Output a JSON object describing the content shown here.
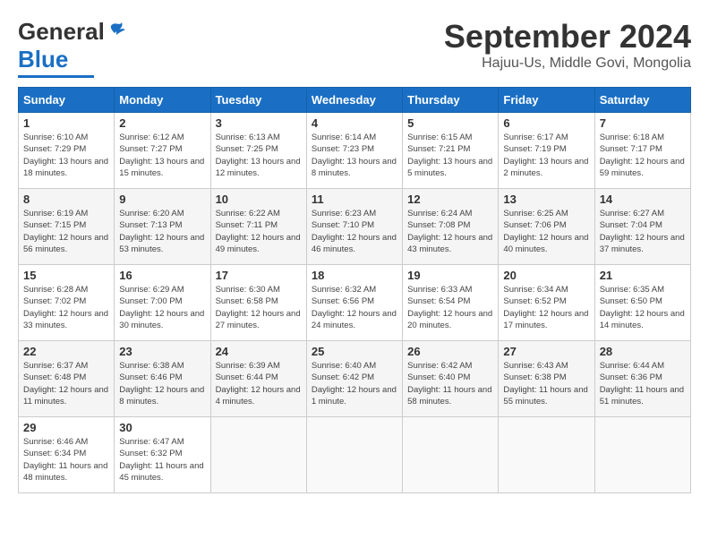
{
  "header": {
    "logo_general": "General",
    "logo_blue": "Blue",
    "title": "September 2024",
    "location": "Hajuu-Us, Middle Govi, Mongolia"
  },
  "weekdays": [
    "Sunday",
    "Monday",
    "Tuesday",
    "Wednesday",
    "Thursday",
    "Friday",
    "Saturday"
  ],
  "weeks": [
    [
      {
        "day": "1",
        "sunrise": "Sunrise: 6:10 AM",
        "sunset": "Sunset: 7:29 PM",
        "daylight": "Daylight: 13 hours and 18 minutes."
      },
      {
        "day": "2",
        "sunrise": "Sunrise: 6:12 AM",
        "sunset": "Sunset: 7:27 PM",
        "daylight": "Daylight: 13 hours and 15 minutes."
      },
      {
        "day": "3",
        "sunrise": "Sunrise: 6:13 AM",
        "sunset": "Sunset: 7:25 PM",
        "daylight": "Daylight: 13 hours and 12 minutes."
      },
      {
        "day": "4",
        "sunrise": "Sunrise: 6:14 AM",
        "sunset": "Sunset: 7:23 PM",
        "daylight": "Daylight: 13 hours and 8 minutes."
      },
      {
        "day": "5",
        "sunrise": "Sunrise: 6:15 AM",
        "sunset": "Sunset: 7:21 PM",
        "daylight": "Daylight: 13 hours and 5 minutes."
      },
      {
        "day": "6",
        "sunrise": "Sunrise: 6:17 AM",
        "sunset": "Sunset: 7:19 PM",
        "daylight": "Daylight: 13 hours and 2 minutes."
      },
      {
        "day": "7",
        "sunrise": "Sunrise: 6:18 AM",
        "sunset": "Sunset: 7:17 PM",
        "daylight": "Daylight: 12 hours and 59 minutes."
      }
    ],
    [
      {
        "day": "8",
        "sunrise": "Sunrise: 6:19 AM",
        "sunset": "Sunset: 7:15 PM",
        "daylight": "Daylight: 12 hours and 56 minutes."
      },
      {
        "day": "9",
        "sunrise": "Sunrise: 6:20 AM",
        "sunset": "Sunset: 7:13 PM",
        "daylight": "Daylight: 12 hours and 53 minutes."
      },
      {
        "day": "10",
        "sunrise": "Sunrise: 6:22 AM",
        "sunset": "Sunset: 7:11 PM",
        "daylight": "Daylight: 12 hours and 49 minutes."
      },
      {
        "day": "11",
        "sunrise": "Sunrise: 6:23 AM",
        "sunset": "Sunset: 7:10 PM",
        "daylight": "Daylight: 12 hours and 46 minutes."
      },
      {
        "day": "12",
        "sunrise": "Sunrise: 6:24 AM",
        "sunset": "Sunset: 7:08 PM",
        "daylight": "Daylight: 12 hours and 43 minutes."
      },
      {
        "day": "13",
        "sunrise": "Sunrise: 6:25 AM",
        "sunset": "Sunset: 7:06 PM",
        "daylight": "Daylight: 12 hours and 40 minutes."
      },
      {
        "day": "14",
        "sunrise": "Sunrise: 6:27 AM",
        "sunset": "Sunset: 7:04 PM",
        "daylight": "Daylight: 12 hours and 37 minutes."
      }
    ],
    [
      {
        "day": "15",
        "sunrise": "Sunrise: 6:28 AM",
        "sunset": "Sunset: 7:02 PM",
        "daylight": "Daylight: 12 hours and 33 minutes."
      },
      {
        "day": "16",
        "sunrise": "Sunrise: 6:29 AM",
        "sunset": "Sunset: 7:00 PM",
        "daylight": "Daylight: 12 hours and 30 minutes."
      },
      {
        "day": "17",
        "sunrise": "Sunrise: 6:30 AM",
        "sunset": "Sunset: 6:58 PM",
        "daylight": "Daylight: 12 hours and 27 minutes."
      },
      {
        "day": "18",
        "sunrise": "Sunrise: 6:32 AM",
        "sunset": "Sunset: 6:56 PM",
        "daylight": "Daylight: 12 hours and 24 minutes."
      },
      {
        "day": "19",
        "sunrise": "Sunrise: 6:33 AM",
        "sunset": "Sunset: 6:54 PM",
        "daylight": "Daylight: 12 hours and 20 minutes."
      },
      {
        "day": "20",
        "sunrise": "Sunrise: 6:34 AM",
        "sunset": "Sunset: 6:52 PM",
        "daylight": "Daylight: 12 hours and 17 minutes."
      },
      {
        "day": "21",
        "sunrise": "Sunrise: 6:35 AM",
        "sunset": "Sunset: 6:50 PM",
        "daylight": "Daylight: 12 hours and 14 minutes."
      }
    ],
    [
      {
        "day": "22",
        "sunrise": "Sunrise: 6:37 AM",
        "sunset": "Sunset: 6:48 PM",
        "daylight": "Daylight: 12 hours and 11 minutes."
      },
      {
        "day": "23",
        "sunrise": "Sunrise: 6:38 AM",
        "sunset": "Sunset: 6:46 PM",
        "daylight": "Daylight: 12 hours and 8 minutes."
      },
      {
        "day": "24",
        "sunrise": "Sunrise: 6:39 AM",
        "sunset": "Sunset: 6:44 PM",
        "daylight": "Daylight: 12 hours and 4 minutes."
      },
      {
        "day": "25",
        "sunrise": "Sunrise: 6:40 AM",
        "sunset": "Sunset: 6:42 PM",
        "daylight": "Daylight: 12 hours and 1 minute."
      },
      {
        "day": "26",
        "sunrise": "Sunrise: 6:42 AM",
        "sunset": "Sunset: 6:40 PM",
        "daylight": "Daylight: 11 hours and 58 minutes."
      },
      {
        "day": "27",
        "sunrise": "Sunrise: 6:43 AM",
        "sunset": "Sunset: 6:38 PM",
        "daylight": "Daylight: 11 hours and 55 minutes."
      },
      {
        "day": "28",
        "sunrise": "Sunrise: 6:44 AM",
        "sunset": "Sunset: 6:36 PM",
        "daylight": "Daylight: 11 hours and 51 minutes."
      }
    ],
    [
      {
        "day": "29",
        "sunrise": "Sunrise: 6:46 AM",
        "sunset": "Sunset: 6:34 PM",
        "daylight": "Daylight: 11 hours and 48 minutes."
      },
      {
        "day": "30",
        "sunrise": "Sunrise: 6:47 AM",
        "sunset": "Sunset: 6:32 PM",
        "daylight": "Daylight: 11 hours and 45 minutes."
      },
      null,
      null,
      null,
      null,
      null
    ]
  ]
}
